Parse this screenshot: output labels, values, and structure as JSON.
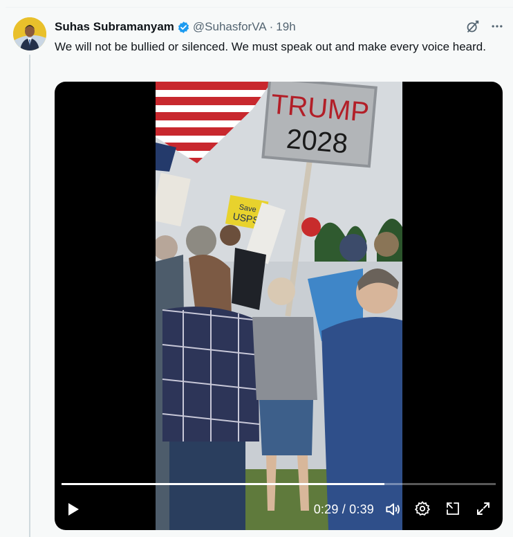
{
  "author": {
    "display_name": "Suhas Subramanyam",
    "handle": "@SuhasforVA",
    "separator": "·",
    "timestamp": "19h",
    "verified": true,
    "verified_color": "#1d9bf0"
  },
  "tweet": {
    "text": "We will not be bullied or silenced. We must speak out and make every voice heard."
  },
  "video": {
    "current_time": "0:29",
    "duration": "0:39",
    "time_separator": " / ",
    "progress": 0.744,
    "frame_sign_text": "TRUMP 2028",
    "frame_sign_line1": "TRUMP",
    "frame_sign_line2": "2028",
    "frame_small_sign_line1": "Save",
    "frame_small_sign_line2": "USPS"
  },
  "icons": {
    "grok": "grok-icon",
    "more": "more-icon",
    "play": "play-icon",
    "volume": "volume-icon",
    "settings": "settings-icon",
    "pip": "picture-in-picture-icon",
    "fullscreen": "fullscreen-icon"
  }
}
